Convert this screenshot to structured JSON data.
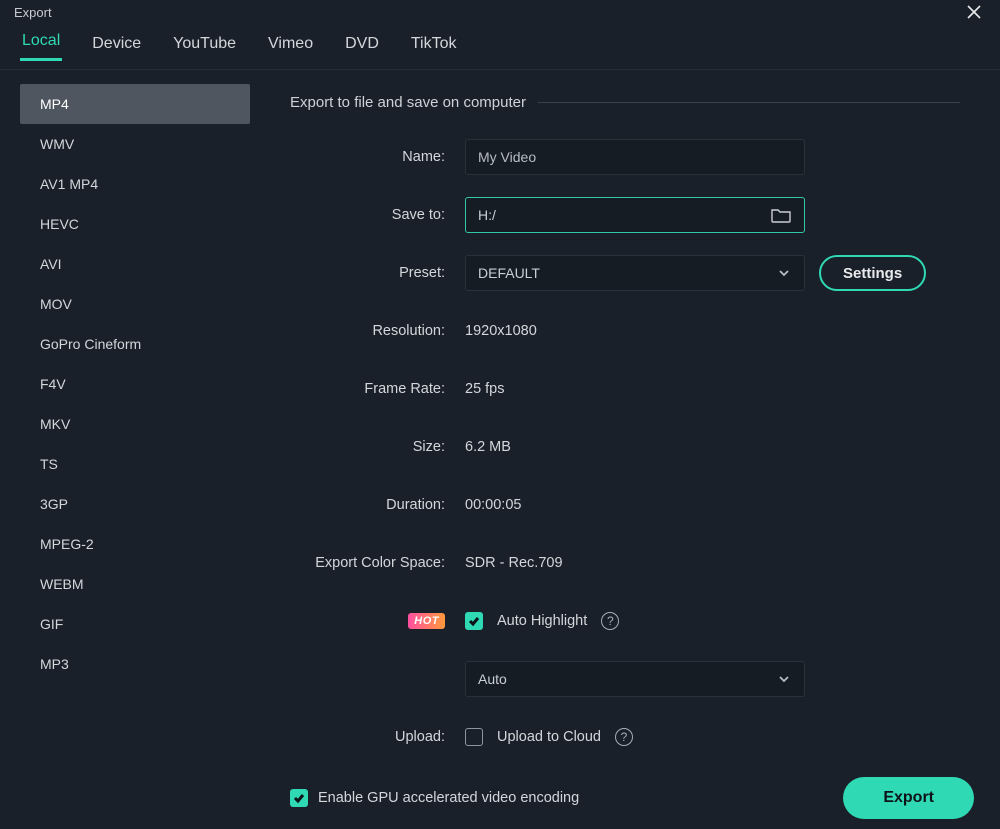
{
  "window": {
    "title": "Export"
  },
  "tabs": [
    "Local",
    "Device",
    "YouTube",
    "Vimeo",
    "DVD",
    "TikTok"
  ],
  "active_tab": 0,
  "formats": [
    "MP4",
    "WMV",
    "AV1 MP4",
    "HEVC",
    "AVI",
    "MOV",
    "GoPro Cineform",
    "F4V",
    "MKV",
    "TS",
    "3GP",
    "MPEG-2",
    "WEBM",
    "GIF",
    "MP3"
  ],
  "active_format": 0,
  "section_heading": "Export to file and save on computer",
  "labels": {
    "name": "Name:",
    "save_to": "Save to:",
    "preset": "Preset:",
    "resolution": "Resolution:",
    "frame_rate": "Frame Rate:",
    "size": "Size:",
    "duration": "Duration:",
    "color_space": "Export Color Space:",
    "upload": "Upload:"
  },
  "fields": {
    "name_value": "My Video",
    "save_to_value": "H:/",
    "preset_value": "DEFAULT",
    "settings_btn": "Settings",
    "resolution_value": "1920x1080",
    "frame_rate_value": "25 fps",
    "size_value": "6.2 MB",
    "duration_value": "00:00:05",
    "color_space_value": "SDR - Rec.709",
    "hot_badge": "HOT",
    "auto_highlight_label": "Auto Highlight",
    "auto_highlight_checked": true,
    "highlight_mode_value": "Auto",
    "upload_cloud_label": "Upload to Cloud",
    "upload_cloud_checked": false
  },
  "footer": {
    "gpu_label": "Enable GPU accelerated video encoding",
    "gpu_checked": true,
    "export_btn": "Export"
  }
}
